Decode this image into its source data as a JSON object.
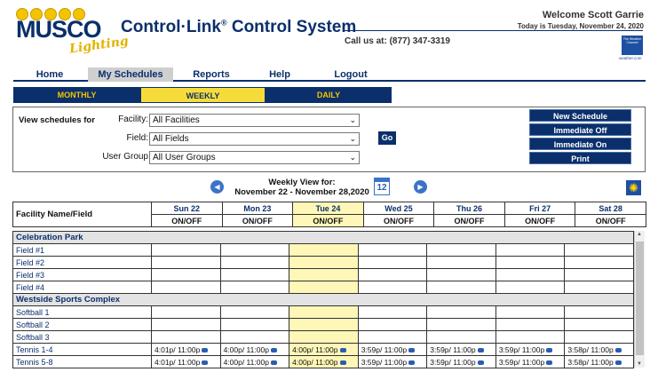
{
  "brand": {
    "logo_text": "MUSCO",
    "logo_script": "Lighting"
  },
  "header": {
    "app_title": "Control·Link",
    "app_title_reg": "®",
    "app_title_rest": " Control System",
    "call_us": "Call us at: (877) 347-3319",
    "welcome": "Welcome Scott Garrie",
    "today": "Today is Tuesday, November 24, 2020",
    "weather_badge": "The Weather Channel",
    "weather_site": "weather.com"
  },
  "nav": {
    "items": [
      {
        "label": "Home"
      },
      {
        "label": "My Schedules"
      },
      {
        "label": "Reports"
      },
      {
        "label": "Help"
      },
      {
        "label": "Logout"
      }
    ],
    "active_index": 1
  },
  "view_tabs": {
    "items": [
      {
        "label": "MONTHLY"
      },
      {
        "label": "WEEKLY"
      },
      {
        "label": "DAILY"
      }
    ],
    "active_index": 1
  },
  "filters": {
    "heading": "View schedules for",
    "facility_label": "Facility:",
    "facility_value": "All Facilities",
    "field_label": "Field:",
    "field_value": "All Fields",
    "user_group_label": "User Group",
    "user_group_value": "All User Groups",
    "go_label": "Go"
  },
  "actions": {
    "new_schedule": "New Schedule",
    "immediate_off": "Immediate Off",
    "immediate_on": "Immediate On",
    "print": "Print"
  },
  "week": {
    "label_line1": "Weekly View for:",
    "label_line2": "November 22 - November 28,2020",
    "calendar_day": "12"
  },
  "grid": {
    "facility_col": "Facility Name/Field",
    "onoff": "ON/OFF",
    "days": [
      "Sun 22",
      "Mon 23",
      "Tue 24",
      "Wed 25",
      "Thu 26",
      "Fri 27",
      "Sat 28"
    ],
    "today_index": 2,
    "groups": [
      {
        "name": "Celebration Park",
        "rows": [
          {
            "name": "Field #1",
            "cells": [
              "",
              "",
              "",
              "",
              "",
              "",
              ""
            ]
          },
          {
            "name": "Field #2",
            "cells": [
              "",
              "",
              "",
              "",
              "",
              "",
              ""
            ]
          },
          {
            "name": "Field #3",
            "cells": [
              "",
              "",
              "",
              "",
              "",
              "",
              ""
            ]
          },
          {
            "name": "Field #4",
            "cells": [
              "",
              "",
              "",
              "",
              "",
              "",
              ""
            ]
          }
        ]
      },
      {
        "name": "Westside Sports Complex",
        "rows": [
          {
            "name": "Softball 1",
            "cells": [
              "",
              "",
              "",
              "",
              "",
              "",
              ""
            ]
          },
          {
            "name": "Softball 2",
            "cells": [
              "",
              "",
              "",
              "",
              "",
              "",
              ""
            ]
          },
          {
            "name": "Softball 3",
            "cells": [
              "",
              "",
              "",
              "",
              "",
              "",
              ""
            ]
          },
          {
            "name": "Tennis 1-4",
            "cells": [
              "4:01p/ 11:00p",
              "4:00p/ 11:00p",
              "4:00p/ 11:00p",
              "3:59p/ 11:00p",
              "3:59p/ 11:00p",
              "3:59p/ 11:00p",
              "3:58p/ 11:00p"
            ]
          },
          {
            "name": "Tennis 5-8",
            "cells": [
              "4:01p/ 11:00p",
              "4:00p/ 11:00p",
              "4:00p/ 11:00p",
              "3:59p/ 11:00p",
              "3:59p/ 11:00p",
              "3:59p/ 11:00p",
              "3:58p/ 11:00p"
            ]
          }
        ]
      }
    ]
  },
  "colors": {
    "navy": "#0a2f6b",
    "gold": "#f5c400",
    "today": "#fff7b8",
    "group": "#e3e3e3"
  }
}
